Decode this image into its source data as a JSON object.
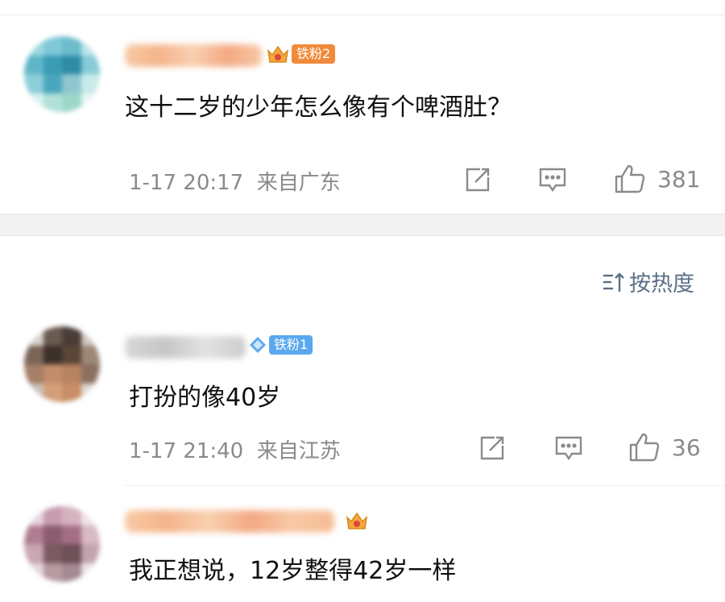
{
  "comments": [
    {
      "badge_label": "铁粉2",
      "text": "这十二岁的少年怎么像有个啤酒肚？",
      "time": "1-17 20:17",
      "location": "来自广东",
      "likes": "381",
      "icons": [
        "share-icon",
        "comment-icon",
        "like-icon"
      ]
    },
    {
      "badge_label": "铁粉1",
      "text": "打扮的像40岁",
      "time": "1-17 21:40",
      "location": "来自江苏",
      "likes": "36",
      "icons": [
        "share-icon",
        "comment-icon",
        "like-icon"
      ]
    },
    {
      "badge_label": "",
      "text": "我正想说，12岁整得42岁一样"
    }
  ],
  "sort": {
    "label": "按热度",
    "icon": "sort-icon"
  },
  "colors": {
    "badge_orange": "#f08a3a",
    "badge_blue": "#5aa8ef",
    "sort_text": "#5a6f86",
    "meta": "#8a8a8a"
  }
}
